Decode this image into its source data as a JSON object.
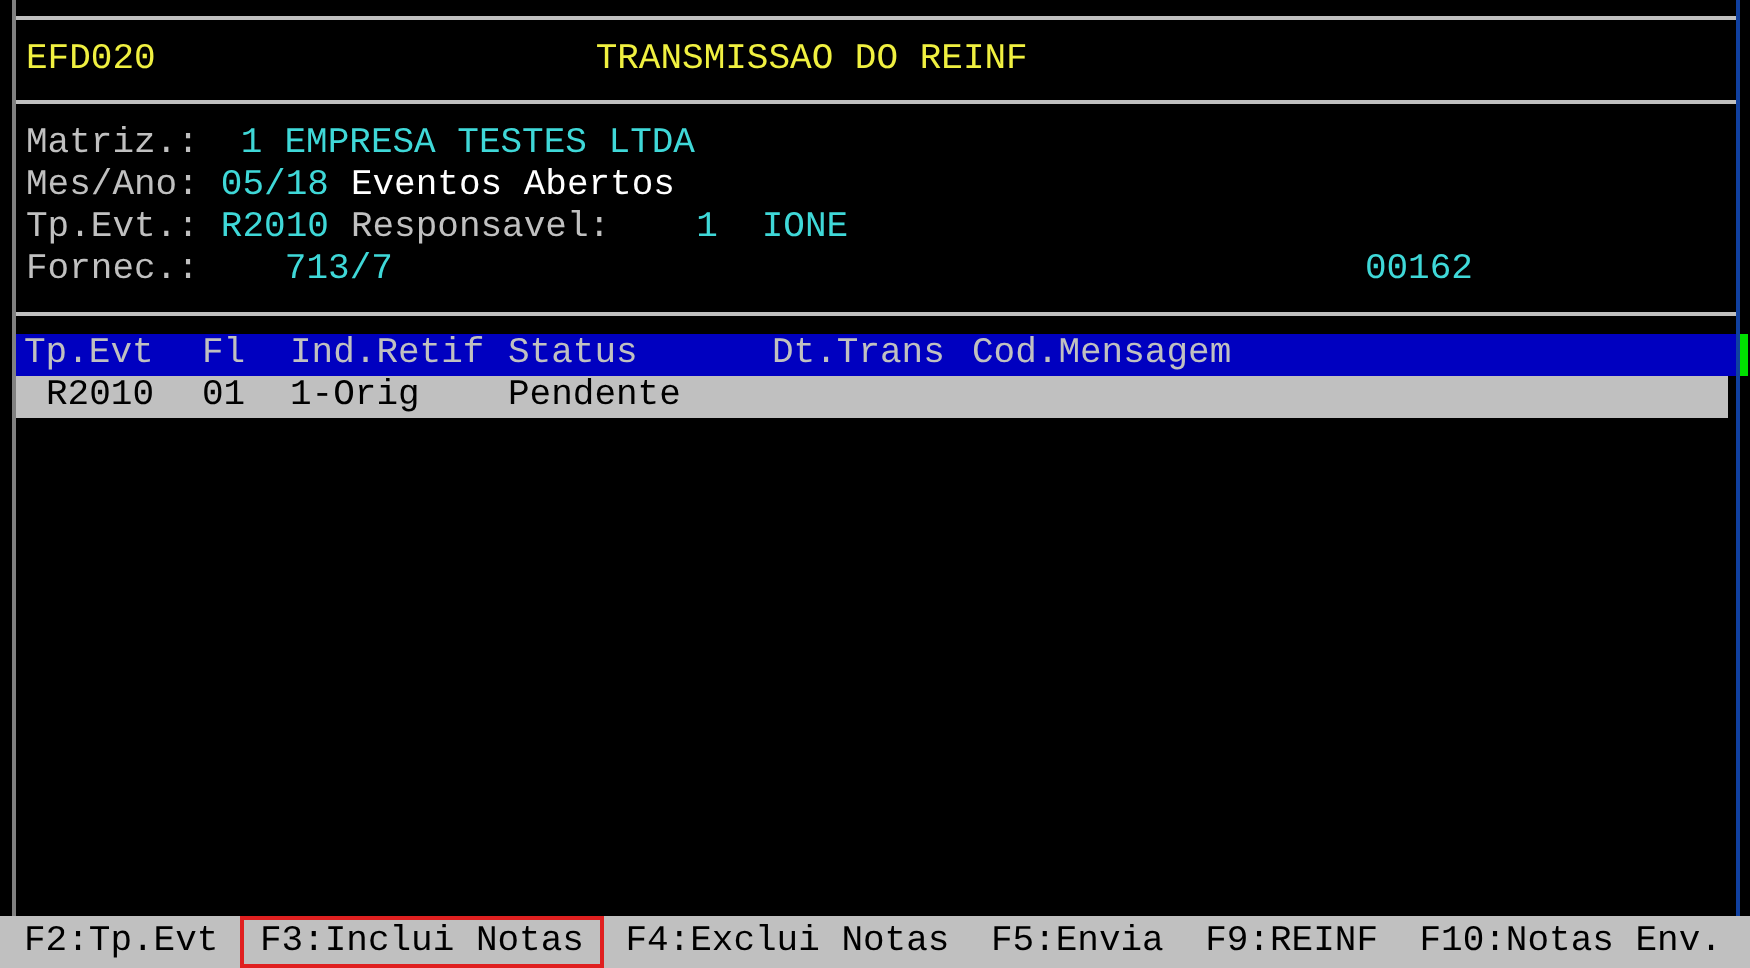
{
  "header": {
    "program": "EFD020",
    "title": "TRANSMISSAO DO REINF"
  },
  "info": {
    "matriz_label": "Matriz.:",
    "matriz_code": "1",
    "matriz_name": "EMPRESA TESTES LTDA",
    "mes_label": "Mes/Ano:",
    "mes_value": "05/18",
    "mes_status": "Eventos Abertos",
    "tp_label": "Tp.Evt.:",
    "tp_value": "R2010",
    "resp_label": "Responsavel:",
    "resp_code": "1",
    "resp_name": "IONE",
    "fornec_label": "Fornec.:",
    "fornec_value": "713/7",
    "counter": "00162"
  },
  "table": {
    "columns": [
      "Tp.Evt",
      "Fl",
      "Ind.Retif",
      "Status",
      "Dt.Trans",
      "Cod.Mensagem"
    ],
    "rows": [
      {
        "selected": true,
        "cells": [
          "R2010",
          "01",
          "1-Orig",
          "Pendente",
          "",
          ""
        ]
      }
    ]
  },
  "function_keys": [
    {
      "label": "F2:Tp.Evt",
      "highlighted": false
    },
    {
      "label": "F3:Inclui Notas",
      "highlighted": true
    },
    {
      "label": "F4:Exclui Notas",
      "highlighted": false
    },
    {
      "label": "F5:Envia",
      "highlighted": false
    },
    {
      "label": "F9:REINF",
      "highlighted": false
    },
    {
      "label": "F10:Notas Env.",
      "highlighted": false
    }
  ]
}
